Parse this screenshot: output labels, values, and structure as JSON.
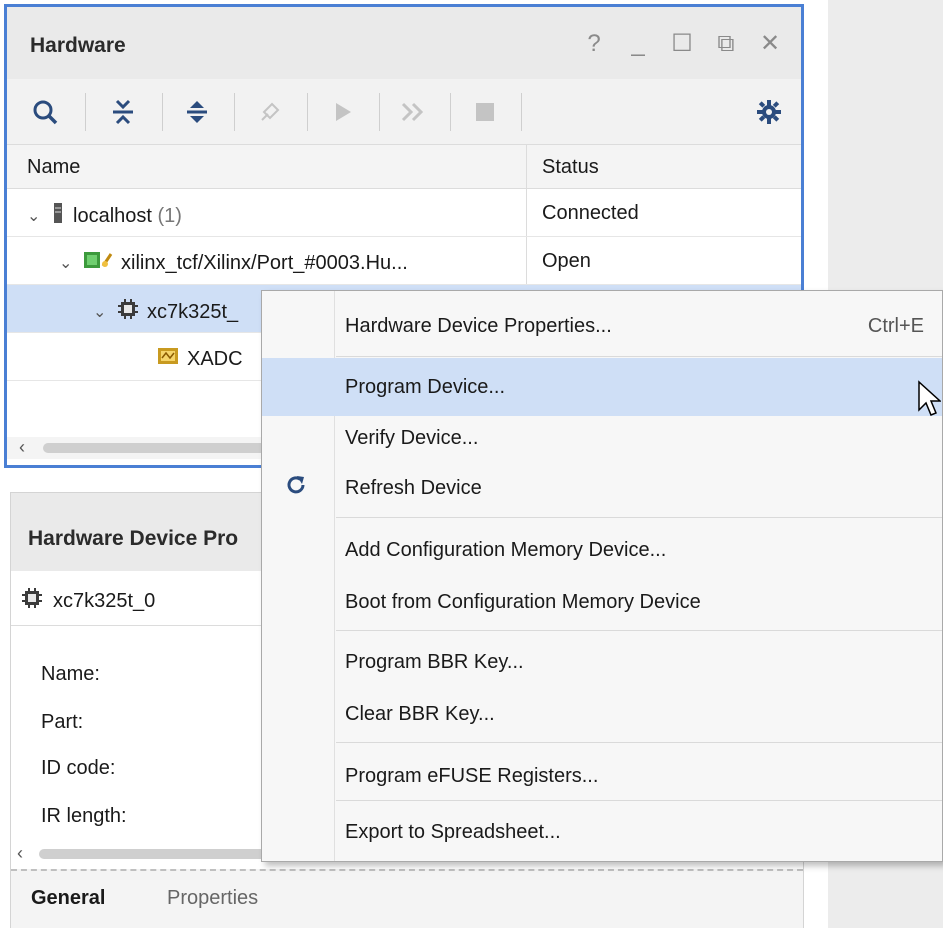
{
  "hardware": {
    "title": "Hardware",
    "window_controls": [
      "?",
      "_",
      "☐",
      "⧉",
      "✕"
    ],
    "columns": {
      "name": "Name",
      "status": "Status"
    },
    "rows": [
      {
        "name": "localhost",
        "count": "(1)",
        "status": "Connected"
      },
      {
        "name": "xilinx_tcf/Xilinx/Port_#0003.Hu...",
        "status": "Open"
      },
      {
        "name": "xc7k325t_",
        "status": ""
      },
      {
        "name": "XADC",
        "status": ""
      }
    ]
  },
  "device_properties": {
    "title": "Hardware Device Pro",
    "device": "xc7k325t_0",
    "props": [
      {
        "label": "Name:"
      },
      {
        "label": "Part:"
      },
      {
        "label": "ID code:"
      },
      {
        "label": "IR length:"
      }
    ],
    "tabs": {
      "general": "General",
      "properties": "Properties"
    }
  },
  "context_menu": {
    "items": [
      {
        "label": "Hardware Device Properties...",
        "shortcut": "Ctrl+E"
      },
      {
        "label": "Program Device..."
      },
      {
        "label": "Verify Device..."
      },
      {
        "label": "Refresh Device",
        "icon": "refresh-icon"
      },
      {
        "label": "Add Configuration Memory Device..."
      },
      {
        "label": "Boot from Configuration Memory Device"
      },
      {
        "label": "Program BBR Key..."
      },
      {
        "label": "Clear BBR Key..."
      },
      {
        "label": "Program eFUSE Registers..."
      },
      {
        "label": "Export to Spreadsheet..."
      }
    ],
    "highlighted": "Program Device..."
  },
  "colors": {
    "accent_border": "#4a7fd4",
    "selection": "#cfdff6"
  }
}
